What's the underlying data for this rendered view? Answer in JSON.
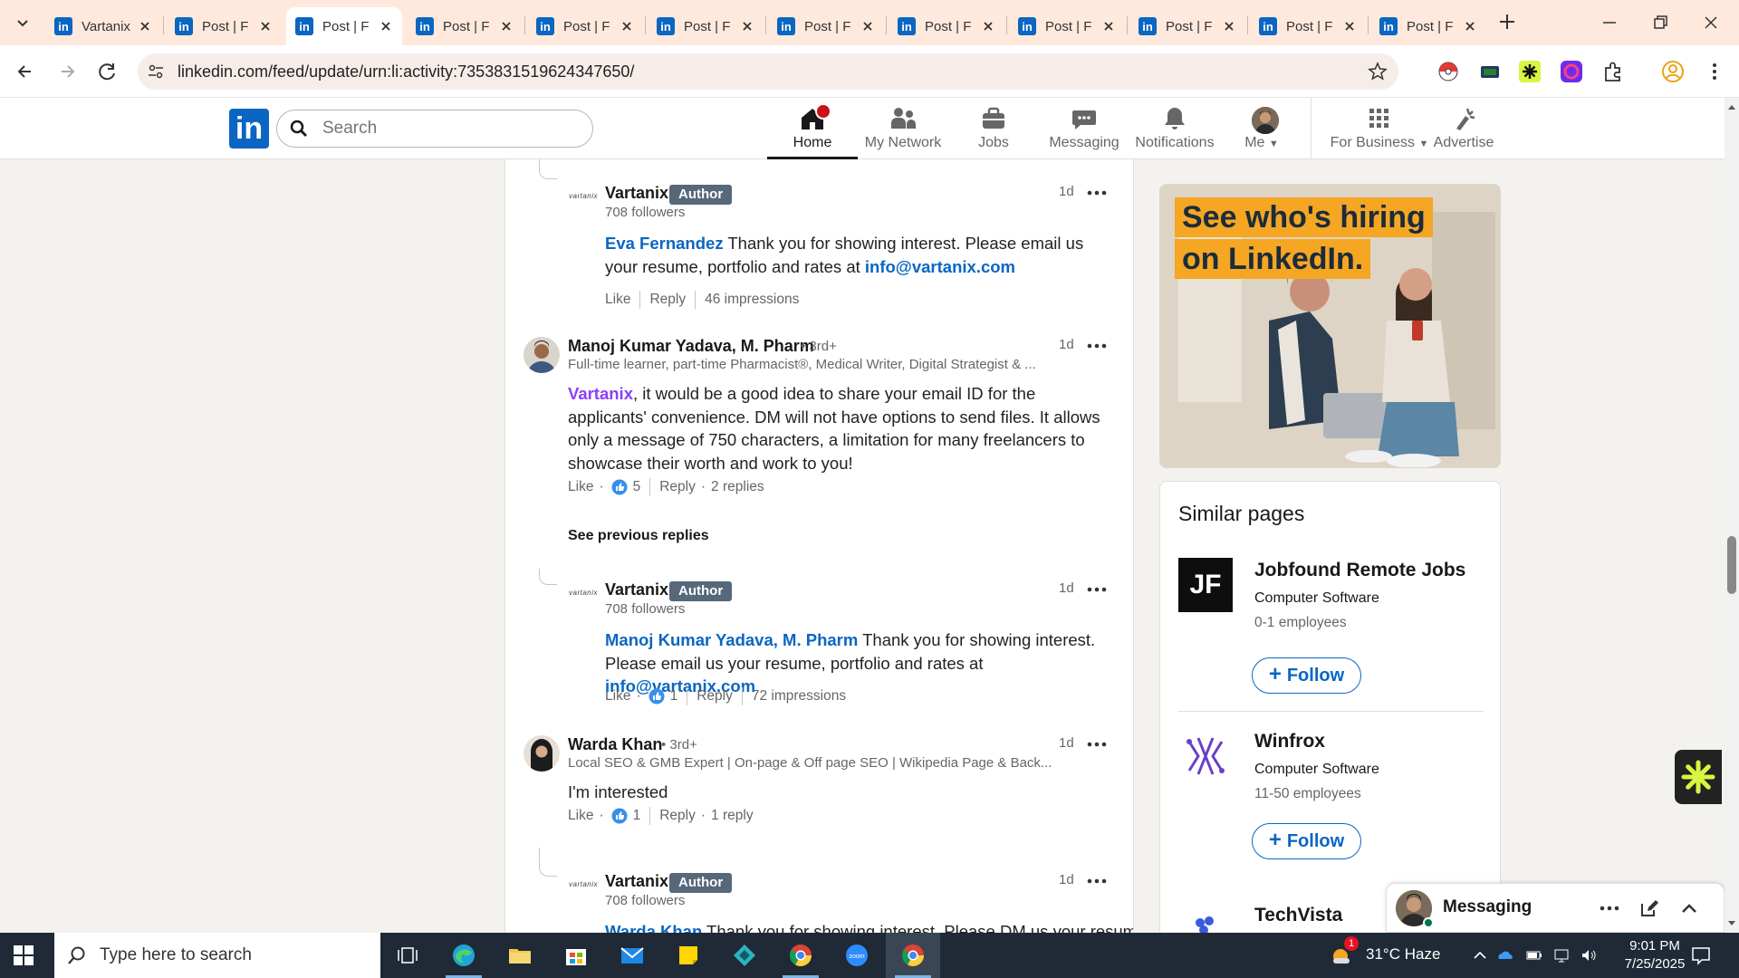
{
  "browser": {
    "tabs": [
      {
        "title": "Vartanix",
        "active": false
      },
      {
        "title": "Post | F",
        "active": false
      },
      {
        "title": "Post | F",
        "active": true
      },
      {
        "title": "Post | F",
        "active": false
      },
      {
        "title": "Post | F",
        "active": false
      },
      {
        "title": "Post | F",
        "active": false
      },
      {
        "title": "Post | F",
        "active": false
      },
      {
        "title": "Post | F",
        "active": false
      },
      {
        "title": "Post | F",
        "active": false
      },
      {
        "title": "Post | F",
        "active": false
      },
      {
        "title": "Post | F",
        "active": false
      },
      {
        "title": "Post | F",
        "active": false
      }
    ],
    "url": "linkedin.com/feed/update/urn:li:activity:7353831519624347650/"
  },
  "linkedin": {
    "logo": "in",
    "search_placeholder": "Search",
    "nav": [
      {
        "label": "Home",
        "icon": "home-icon",
        "active": true
      },
      {
        "label": "My Network",
        "icon": "network-icon",
        "active": false
      },
      {
        "label": "Jobs",
        "icon": "jobs-icon",
        "active": false
      },
      {
        "label": "Messaging",
        "icon": "messaging-icon",
        "active": false
      },
      {
        "label": "Notifications",
        "icon": "bell-icon",
        "active": false
      },
      {
        "label": "Me",
        "icon": "avatar",
        "active": false
      },
      {
        "label": "For Business",
        "icon": "grid-icon",
        "active": false
      },
      {
        "label": "Advertise",
        "icon": "advertise-icon",
        "active": false
      }
    ]
  },
  "comments": {
    "c1": {
      "name": "Vartanix",
      "badge": "Author",
      "sub": "708 followers",
      "time": "1d",
      "mention": "Eva Fernandez",
      "text": " Thank you for showing interest. Please email us your resume, portfolio and rates at ",
      "link": "info@vartanix.com",
      "like": "Like",
      "reply": "Reply",
      "impressions": "46 impressions"
    },
    "c2": {
      "name": "Manoj Kumar Yadava, M. Pharm",
      "degree": "• 3rd+",
      "sub": "Full-time learner, part-time Pharmacist®, Medical Writer, Digital Strategist & ...",
      "time": "1d",
      "mention": "Vartanix",
      "text": ", it would be a good idea to share your email ID for the applicants' convenience. DM will not have options to send files. It allows only a message of 750 characters, a limitation for many freelancers to showcase their worth and work to you!",
      "like": "Like",
      "like_count": "5",
      "reply": "Reply",
      "replies": "2 replies",
      "see_previous": "See previous replies"
    },
    "c3": {
      "name": "Vartanix",
      "badge": "Author",
      "sub": "708 followers",
      "time": "1d",
      "mention": "Manoj Kumar Yadava, M. Pharm",
      "text": " Thank you for showing interest. Please email us your resume, portfolio and rates at ",
      "link": "info@vartanix.com",
      "like": "Like",
      "like_count": "1",
      "reply": "Reply",
      "impressions": "72 impressions"
    },
    "c4": {
      "name": "Warda Khan",
      "degree": "• 3rd+",
      "sub": "Local SEO & GMB Expert | On-page & Off page SEO | Wikipedia Page & Back...",
      "time": "1d",
      "text": "I'm interested",
      "like": "Like",
      "like_count": "1",
      "reply": "Reply",
      "replies": "1 reply"
    },
    "c5": {
      "name": "Vartanix",
      "badge": "Author",
      "sub": "708 followers",
      "time": "1d",
      "mention": "Warda Khan",
      "text": " Thank you for showing interest. Please DM us your resume"
    },
    "logo_text": "vartanix"
  },
  "ad": {
    "line1": "See who's hiring",
    "line2": "on LinkedIn."
  },
  "similar_pages": {
    "title": "Similar pages",
    "items": [
      {
        "name": "Jobfound Remote Jobs",
        "category": "Computer Software",
        "employees": "0-1 employees",
        "logo_text": "JF",
        "follow": "Follow"
      },
      {
        "name": "Winfrox",
        "category": "Computer Software",
        "employees": "11-50 employees",
        "follow": "Follow"
      },
      {
        "name": "TechVista"
      }
    ]
  },
  "messaging": {
    "title": "Messaging"
  },
  "taskbar": {
    "search_placeholder": "Type here to search",
    "weather": "31°C  Haze",
    "time": "9:01 PM",
    "date": "7/25/2025",
    "notification_count": "1"
  },
  "colors": {
    "linkedin_blue": "#0a66c2",
    "tabstrip": "#ffe9dd",
    "author_badge": "#56687a",
    "notification_red": "#cc1016",
    "taskbar": "#1f2a36"
  }
}
